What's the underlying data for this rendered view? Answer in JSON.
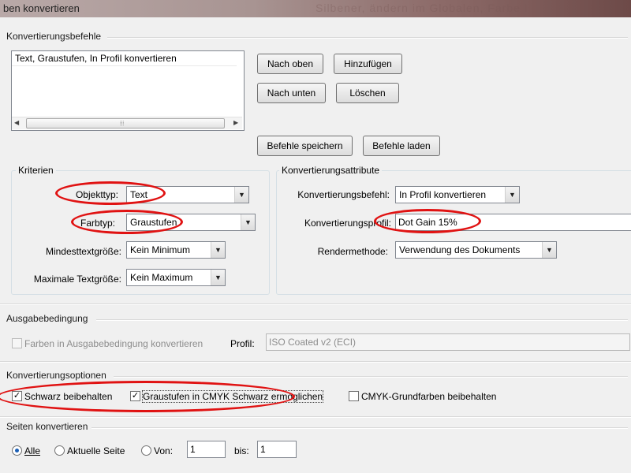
{
  "window": {
    "title": "ben konvertieren",
    "bg_text": "Silbener, ändern im Globalen, Farbe I"
  },
  "commands": {
    "section_label": "Konvertierungsbefehle",
    "list_items": [
      "Text, Graustufen, In Profil konvertieren"
    ],
    "btn_up": "Nach oben",
    "btn_add": "Hinzufügen",
    "btn_down": "Nach unten",
    "btn_delete": "Löschen",
    "btn_save": "Befehle speichern",
    "btn_load": "Befehle laden"
  },
  "criteria": {
    "title": "Kriterien",
    "objecttype_label": "Objekttyp:",
    "objecttype_value": "Text",
    "colortype_label": "Farbtyp:",
    "colortype_value": "Graustufen",
    "min_text_label": "Mindesttextgröße:",
    "min_text_value": "Kein Minimum",
    "max_text_label": "Maximale Textgröße:",
    "max_text_value": "Kein Maximum"
  },
  "attributes": {
    "title": "Konvertierungsattribute",
    "command_label": "Konvertierungsbefehl:",
    "command_value": "In Profil konvertieren",
    "profile_label": "Konvertierungsprofil:",
    "profile_value": "Dot Gain 15%",
    "render_label": "Rendermethode:",
    "render_value": "Verwendung des Dokuments"
  },
  "output": {
    "section_label": "Ausgabebedingung",
    "checkbox_label": "Farben in Ausgabebedingung konvertieren",
    "profile_label": "Profil:",
    "profile_value": "ISO Coated v2 (ECI)"
  },
  "options": {
    "section_label": "Konvertierungsoptionen",
    "keep_black_label": "Schwarz beibehalten",
    "keep_black_checked": true,
    "gray_to_cmyk_label": "Graustufen in CMYK Schwarz ermöglichen",
    "gray_to_cmyk_checked": true,
    "keep_cmyk_label": "CMYK-Grundfarben beibehalten",
    "keep_cmyk_checked": false
  },
  "pages": {
    "section_label": "Seiten konvertieren",
    "all_label": "Alle",
    "current_label": "Aktuelle Seite",
    "from_label": "Von:",
    "from_value": "1",
    "to_label": "bis:",
    "to_value": "1",
    "selected": "all"
  },
  "icons": {
    "check": "✓",
    "dropdown": "▼",
    "scroll_left": "◀",
    "scroll_right": "▶",
    "grip": "⦙⦙⦙"
  },
  "colors": {
    "highlight": "#e01212",
    "radio_accent": "#1b5fb5"
  }
}
